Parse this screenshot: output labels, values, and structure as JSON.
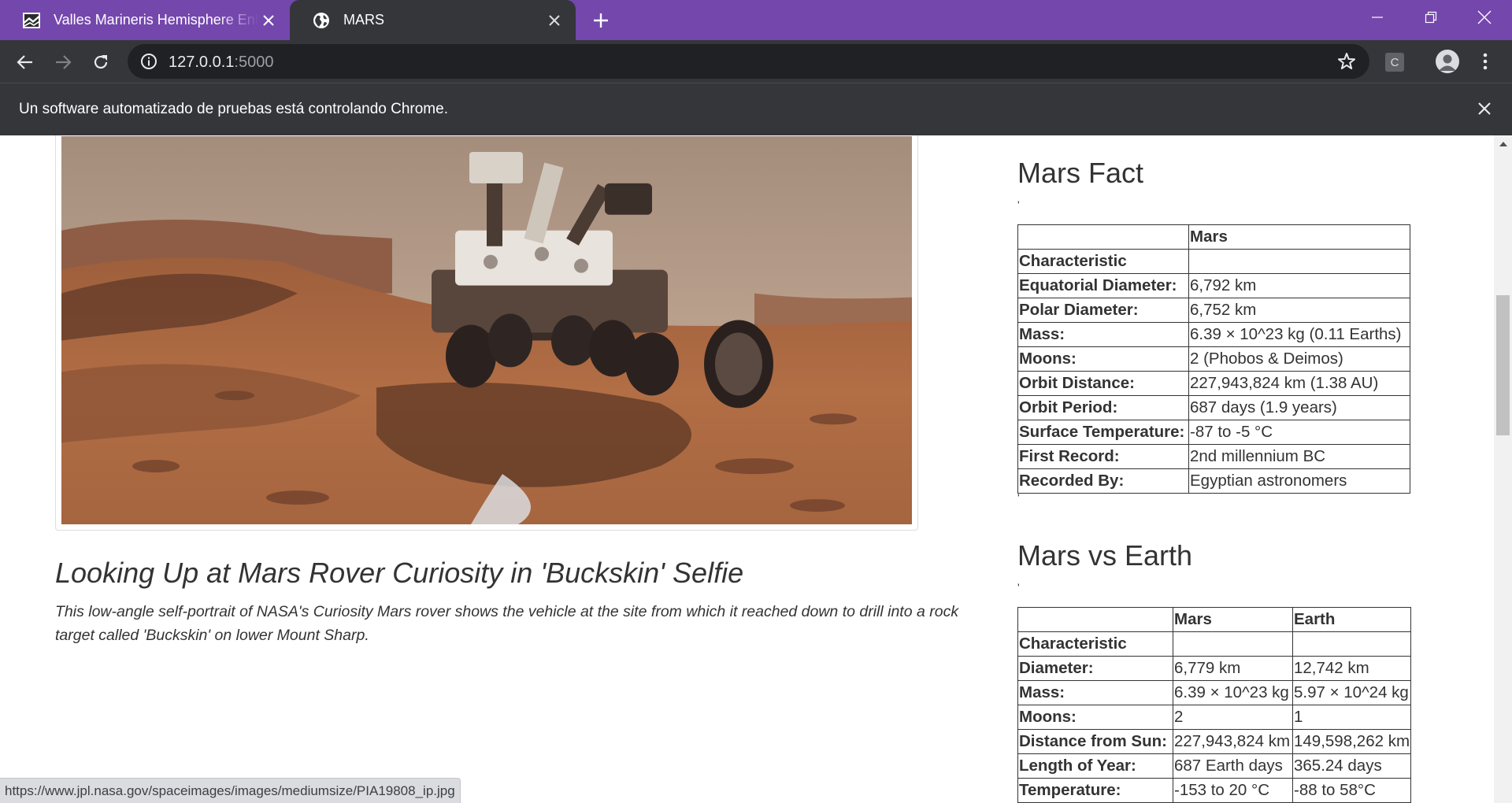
{
  "browser": {
    "tabs": [
      {
        "title": "Valles Marineris Hemisphere Enhanced",
        "favicon": "landscape-icon",
        "active": false
      },
      {
        "title": "MARS",
        "favicon": "globe-icon",
        "active": true
      }
    ],
    "address": {
      "host": "127.0.0.1",
      "port": ":5000"
    },
    "extension_label": "C",
    "infobar_message": "Un software automatizado de pruebas está controlando Chrome.",
    "status_url": "https://www.jpl.nasa.gov/spaceimages/images/mediumsize/PIA19808_ip.jpg",
    "colors": {
      "frame": "#7447ad",
      "toolbar": "#35363a",
      "omnibox": "#202124"
    }
  },
  "featured": {
    "image_alt": "Curiosity rover selfie at Buckskin",
    "title": "Looking Up at Mars Rover Curiosity in 'Buckskin' Selfie",
    "description": "This low-angle self-portrait of NASA's Curiosity Mars rover shows the vehicle at the site from which it reached down to drill into a rock target called 'Buckskin' on lower Mount Sharp."
  },
  "mars_facts": {
    "title": "Mars Fact",
    "tick": "'",
    "header": [
      "",
      "Mars"
    ],
    "index_label": "Characteristic",
    "rows": [
      [
        "Equatorial Diameter:",
        "6,792 km"
      ],
      [
        "Polar Diameter:",
        "6,752 km"
      ],
      [
        "Mass:",
        "6.39 × 10^23 kg (0.11 Earths)"
      ],
      [
        "Moons:",
        "2 (Phobos & Deimos)"
      ],
      [
        "Orbit Distance:",
        "227,943,824 km (1.38 AU)"
      ],
      [
        "Orbit Period:",
        "687 days (1.9 years)"
      ],
      [
        "Surface Temperature:",
        "-87 to -5 °C"
      ],
      [
        "First Record:",
        "2nd millennium BC"
      ],
      [
        "Recorded By:",
        "Egyptian astronomers"
      ]
    ],
    "trailing_tick": "'"
  },
  "mars_vs_earth": {
    "title": "Mars vs Earth",
    "tick": "'",
    "header": [
      "",
      "Mars",
      "Earth"
    ],
    "index_label": "Characteristic",
    "rows": [
      [
        "Diameter:",
        "6,779 km",
        "12,742 km"
      ],
      [
        "Mass:",
        "6.39 × 10^23 kg",
        "5.97 × 10^24 kg"
      ],
      [
        "Moons:",
        "2",
        "1"
      ],
      [
        "Distance from Sun:",
        "227,943,824 km",
        "149,598,262 km"
      ],
      [
        "Length of Year:",
        "687 Earth days",
        "365.24 days"
      ],
      [
        "Temperature:",
        "-153 to 20 °C",
        "-88 to 58°C"
      ]
    ]
  }
}
